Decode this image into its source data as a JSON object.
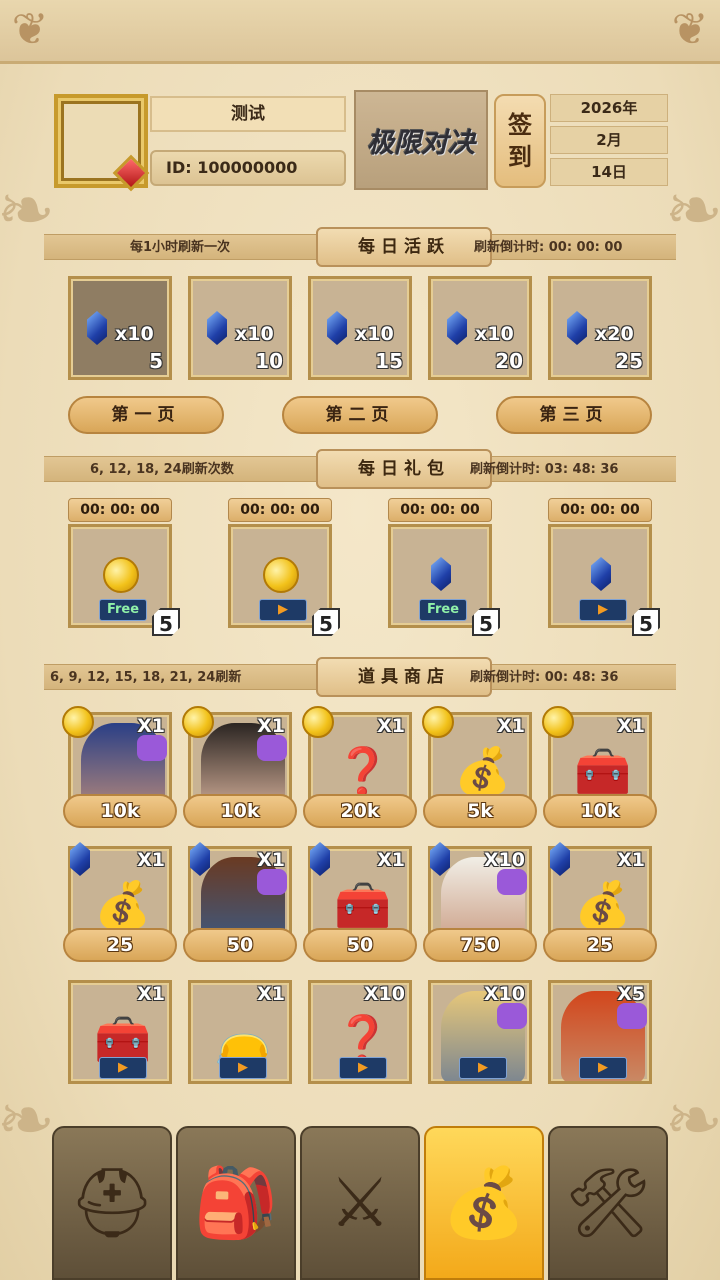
{
  "player": {
    "name": "测试",
    "id_label": "ID: 100000000"
  },
  "logo_text": "极限对决",
  "signin": {
    "char1": "签",
    "char2": "到"
  },
  "date": {
    "year": "2026年",
    "month": "2月",
    "day": "14日"
  },
  "daily_activity": {
    "title": "每日活跃",
    "left_note": "每1小时刷新一次",
    "right_note": "刷新倒计时: 00: 00: 00",
    "rewards": [
      {
        "icon": "blue-gem-icon",
        "qty": "x10",
        "points": "5"
      },
      {
        "icon": "blue-gem-icon",
        "qty": "x10",
        "points": "10"
      },
      {
        "icon": "blue-gem-icon",
        "qty": "x10",
        "points": "15"
      },
      {
        "icon": "blue-gem-icon",
        "qty": "x10",
        "points": "20"
      },
      {
        "icon": "blue-gem-icon",
        "qty": "x20",
        "points": "25"
      }
    ],
    "pages": [
      "第一页",
      "第二页",
      "第三页"
    ]
  },
  "daily_gift": {
    "title": "每日礼包",
    "left_note": "6, 12, 18, 24刷新次数",
    "right_note": "刷新倒计时: 03: 48: 36",
    "gifts": [
      {
        "timer": "00: 00: 00",
        "icon": "gold-coin-icon",
        "tag": "Free",
        "count": "5"
      },
      {
        "timer": "00: 00: 00",
        "icon": "gold-coin-icon",
        "tag": "▶",
        "count": "5"
      },
      {
        "timer": "00: 00: 00",
        "icon": "blue-gem-icon",
        "tag": "Free",
        "count": "5"
      },
      {
        "timer": "00: 00: 00",
        "icon": "blue-gem-icon",
        "tag": "▶",
        "count": "5"
      }
    ]
  },
  "shop": {
    "title": "道具商店",
    "left_note": "6, 9, 12, 15, 18, 21, 24刷新",
    "right_note": "刷新倒计时: 00: 48: 36",
    "row1": [
      {
        "item": "hero-portrait-blue-hair",
        "qty": "X1",
        "price": "10k"
      },
      {
        "item": "hero-portrait-dark-hair",
        "qty": "X1",
        "price": "10k"
      },
      {
        "item": "mystery-card",
        "qty": "X1",
        "price": "20k"
      },
      {
        "item": "red-loot-bag",
        "qty": "X1",
        "price": "5k"
      },
      {
        "item": "red-treasure-chest",
        "qty": "X1",
        "price": "10k"
      }
    ],
    "row2": [
      {
        "item": "red-loot-bag",
        "qty": "X1",
        "price": "25"
      },
      {
        "item": "hero-portrait-cyborg",
        "qty": "X1",
        "price": "50"
      },
      {
        "item": "red-treasure-chest",
        "qty": "X1",
        "price": "50"
      },
      {
        "item": "hero-portrait-hooded",
        "qty": "X10",
        "price": "750"
      },
      {
        "item": "red-loot-bag",
        "qty": "X1",
        "price": "25"
      }
    ],
    "row3": [
      {
        "item": "red-cross-chest",
        "qty": "X1"
      },
      {
        "item": "red-pouch",
        "qty": "X1"
      },
      {
        "item": "mystery-card",
        "qty": "X10"
      },
      {
        "item": "hero-portrait-masked",
        "qty": "X10"
      },
      {
        "item": "hero-portrait-red-hair",
        "qty": "X5"
      }
    ]
  },
  "nav": [
    {
      "icon": "helmet-icon",
      "glyph": "⛑"
    },
    {
      "icon": "backpack-icon",
      "glyph": "🎒"
    },
    {
      "icon": "crossed-swords-icon",
      "glyph": "⚔"
    },
    {
      "icon": "treasure-chest-icon",
      "glyph": "💰"
    },
    {
      "icon": "wrench-hammer-icon",
      "glyph": "🛠"
    }
  ],
  "colors": {
    "background": "#efe0bf",
    "gold": "#c79a2c",
    "active_tab": "#f3a91a",
    "cell": "#c8b394"
  }
}
